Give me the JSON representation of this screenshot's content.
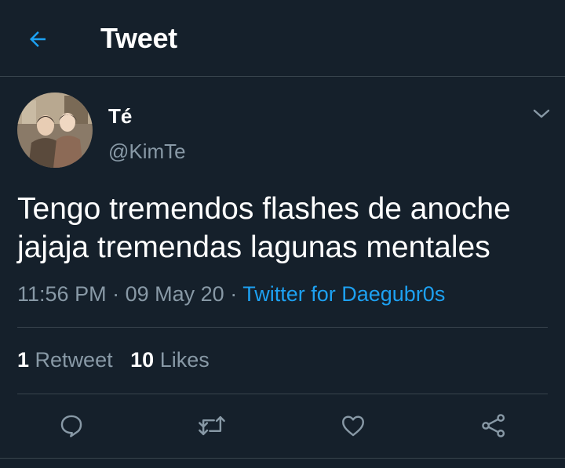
{
  "header": {
    "title": "Tweet",
    "back_icon": "arrow-left-icon"
  },
  "author": {
    "display_name": "Té",
    "handle": "@KimTe"
  },
  "tweet": {
    "text_line1": "Tengo tremendos flashes de anoche",
    "text_line2": "jajaja tremendas lagunas mentales",
    "time": "11:56 PM",
    "date": "09 May 20",
    "separator": "·",
    "source": "Twitter for Daegubr0s"
  },
  "stats": {
    "retweets_count": "1",
    "retweets_label": "Retweet",
    "likes_count": "10",
    "likes_label": "Likes"
  },
  "actions": [
    "reply-icon",
    "retweet-icon",
    "like-icon",
    "share-icon"
  ],
  "colors": {
    "background": "#15202b",
    "accent": "#1da1f2",
    "secondary": "#8899a6",
    "divider": "#38444d"
  }
}
